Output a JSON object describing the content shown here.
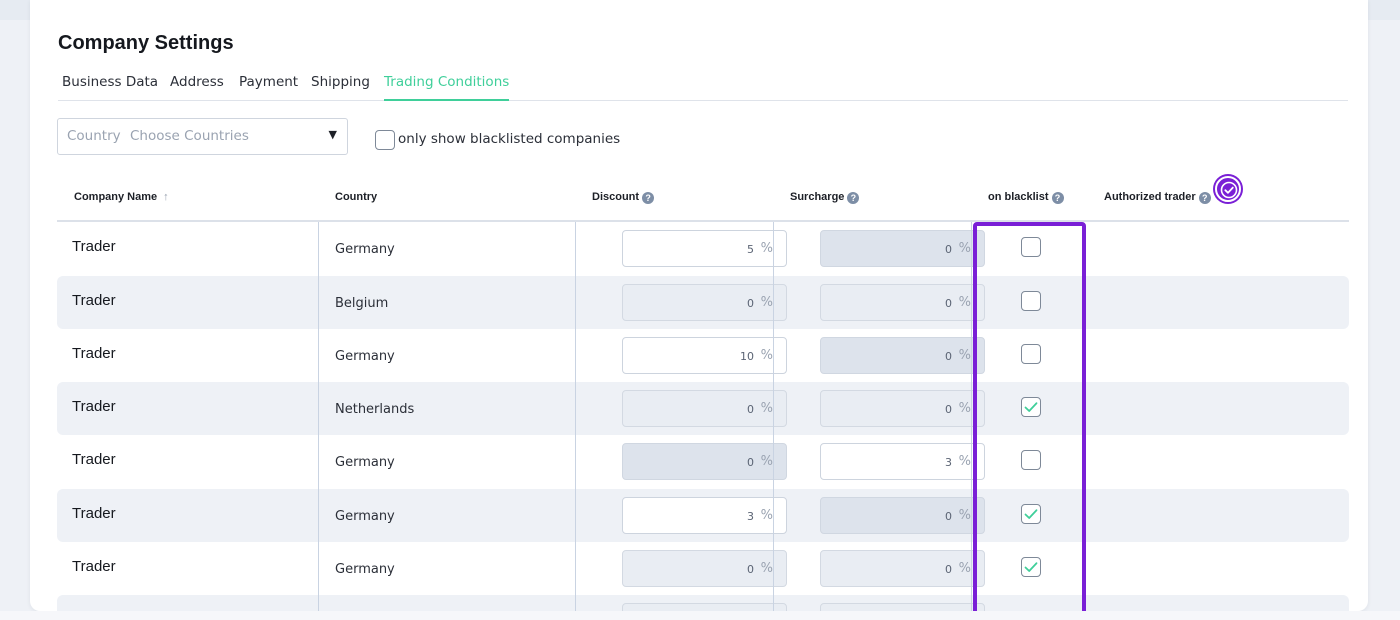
{
  "page_title": "Company Settings",
  "tabs": [
    {
      "label": "Business Data",
      "active": false
    },
    {
      "label": "Address",
      "active": false
    },
    {
      "label": "Payment",
      "active": false
    },
    {
      "label": "Shipping",
      "active": false
    },
    {
      "label": "Trading Conditions",
      "active": true
    }
  ],
  "filters": {
    "country_label": "Country",
    "country_placeholder": "Choose Countries",
    "blacklist_only_label": "only show blacklisted companies",
    "blacklist_only_checked": false
  },
  "columns": {
    "company": "Company Name",
    "country": "Country",
    "discount": "Discount",
    "surcharge": "Surcharge",
    "blacklist": "on blacklist",
    "authorized": "Authorized trader"
  },
  "percent_unit": "%",
  "rows": [
    {
      "name": "Trader",
      "country": "Germany",
      "discount": "5",
      "surcharge": "0",
      "blacklisted": false
    },
    {
      "name": "Trader",
      "country": "Belgium",
      "discount": "0",
      "surcharge": "0",
      "blacklisted": false
    },
    {
      "name": "Trader",
      "country": "Germany",
      "discount": "10",
      "surcharge": "0",
      "blacklisted": false
    },
    {
      "name": "Trader",
      "country": "Netherlands",
      "discount": "0",
      "surcharge": "0",
      "blacklisted": true
    },
    {
      "name": "Trader",
      "country": "Germany",
      "discount": "0",
      "surcharge": "3",
      "blacklisted": false
    },
    {
      "name": "Trader",
      "country": "Germany",
      "discount": "3",
      "surcharge": "0",
      "blacklisted": true
    },
    {
      "name": "Trader",
      "country": "Germany",
      "discount": "0",
      "surcharge": "0",
      "blacklisted": true
    }
  ],
  "colors": {
    "accent": "#3fcf9a",
    "highlight": "#7a1fd6",
    "help_icon": "#7d8ea6"
  },
  "icons": {
    "sort": "arrow-up-icon",
    "help": "question-circle-icon",
    "dropdown": "caret-down-icon",
    "badge": "verified-check-badge-icon",
    "check": "checkmark-icon"
  }
}
